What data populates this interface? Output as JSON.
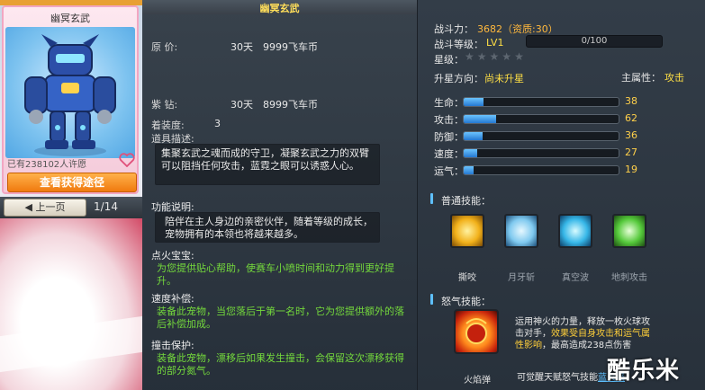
{
  "left": {
    "pet_name": "幽冥玄武",
    "permits": "已有238102人许愿",
    "get_button": "查看获得途径",
    "prev_button": "◀ 上一页",
    "page": "1/14"
  },
  "middle": {
    "title": "幽冥玄武",
    "original_price_label": "原 价:",
    "original_price_days": "30天",
    "original_price_value": "9999飞车币",
    "purple_label": "紫 钻:",
    "purple_days": "30天",
    "purple_value": "8999飞车币",
    "equip_label": "着装度:",
    "equip_value": "3",
    "desc_label": "道具描述:",
    "desc_text": "集聚玄武之魂而成的守卫，凝聚玄武之力的双臂可以阻挡任何攻击，蓝霓之眼可以诱惑人心。",
    "function_label": "功能说明:",
    "function_text": "陪伴在主人身边的亲密伙伴，随着等级的成长，宠物拥有的本领也将越来越多。",
    "fire_label": "点火宝宝:",
    "fire_text": "为您提供贴心帮助，使赛车小喷时间和动力得到更好提升。",
    "speed_label": "速度补偿:",
    "speed_text": "装备此宠物，当您落后于第一名时，它为您提供额外的落后补偿加成。",
    "crash_label": "撞击保护:",
    "crash_text": "装备此宠物，漂移后如果发生撞击，会保留这次漂移获得的部分氮气。"
  },
  "right": {
    "power_label": "战斗力：",
    "power_value": "3682（资质:30）",
    "level_label": "战斗等级：",
    "level_value": "LV1",
    "exp_text": "0/100",
    "exp_fraction": 0,
    "stars_label": "星级：",
    "stars_total": 5,
    "stars_filled": 0,
    "upgrade_label": "升星方向：",
    "upgrade_value": "尚未升星",
    "main_attr_label": "主属性：",
    "main_attr_value": "攻击",
    "stats": [
      {
        "label": "生命：",
        "value": "38",
        "max": 300
      },
      {
        "label": "攻击：",
        "value": "62",
        "max": 300
      },
      {
        "label": "防御：",
        "value": "36",
        "max": 300
      },
      {
        "label": "速度：",
        "value": "27",
        "max": 300
      },
      {
        "label": "运气：",
        "value": "19",
        "max": 300
      }
    ],
    "normal_skills_label": "普通技能：",
    "normal_skills": [
      "撕咬",
      "月牙斩",
      "真空波",
      "地刺攻击"
    ],
    "rage_skills_label": "怒气技能：",
    "rage_skill_name": "火焰弹",
    "rage_desc_1": "运用神火的力量，释放一枚火球攻击对手，",
    "rage_desc_hl": "效果受自身攻击和运气属性影响",
    "rage_desc_2": "，最高造成238点伤害",
    "awaken_text": "可觉醒天赋怒气技能",
    "awaken_link": "蓝火焰"
  },
  "watermark": "酷乐米",
  "colors": {
    "accent_orange": "#f07a0e",
    "title_yellow": "#ffde5a",
    "green_text": "#74d93c",
    "stat_blue": "#2478d2"
  }
}
